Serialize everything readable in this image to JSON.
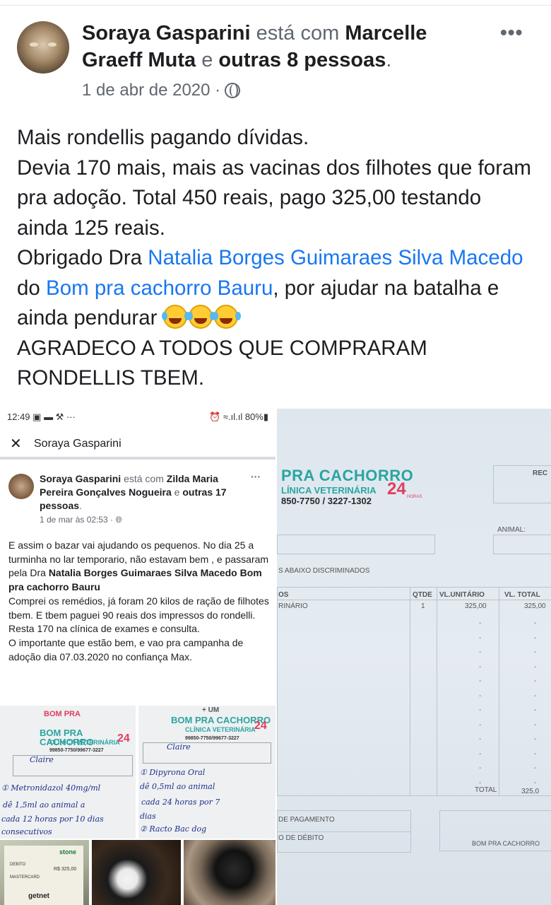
{
  "post": {
    "author": "Soraya Gasparini",
    "with_text": "está com",
    "tagged": "Marcelle Graeff Muta",
    "and_text": "e",
    "others": "outras 8 pessoas",
    "period": ".",
    "date": "1 de abr de 2020 ·",
    "more_icon": "•••",
    "body": {
      "line1": "Mais rondellis pagando dívidas.",
      "line2": "Devia 170 mais, mais as vacinas dos filhotes que foram pra adoção. Total 450 reais, pago 325,00 testando ainda 125 reais.",
      "thanks_prefix": "Obrigado Dra",
      "doctor_link": "Natalia Borges Guimaraes Silva Macedo",
      "from_text": "do",
      "clinic_link": "Bom pra cachorro Bauru",
      "thanks_suffix": ", por ajudar na batalha e ainda pendurar",
      "line4": "AGRADECO A TODOS QUE COMPRARAM RONDELLIS TBEM."
    }
  },
  "screenshot": {
    "status_time": "12:49",
    "status_icons_left": "▣ ▬ ⚒ ···",
    "status_right": "⏰ ≈.ıl.ıl 80%▮",
    "title": "Soraya Gasparini",
    "close_icon": "✕",
    "inner_post": {
      "author": "Soraya Gasparini",
      "with_text": "está com",
      "tagged": "Zilda Maria Pereira Gonçalves Nogueira",
      "and_text": "e",
      "others": "outras 17 pessoas",
      "period": ".",
      "date": "1 de mar às 02:53 ·",
      "more_icon": "···",
      "body_a": "E assim o bazar vai ajudando os pequenos. No dia 25 a turminha no lar temporario, não estavam bem , e passaram pela Dra",
      "body_bold": "Natalia Borges Guimaraes Silva Macedo Bom pra cachorro Bauru",
      "body_b": "Comprei os remédios,  já foram 20 kilos de ração de filhotes tbem. E tbem paguei 90 reais dos impressos do rondelli.",
      "body_c": "Resta 170 na clínica de exames e consulta.",
      "body_d": "O importante que estão bem, e vao pra campanha de adoção dia 07.03.2020 no confiança Max."
    },
    "receipt_a": {
      "logo_top": "BOM PRA",
      "logo": "BOM PRA CACHORRO",
      "sub": "CLÍNICA VETERINÁRIA",
      "phone": "99850-7750/99677-3227",
      "num": "24",
      "note1": "Claire",
      "note2": "① Metronidazol 40mg/ml",
      "note3": "dê 1,5ml ao animal a",
      "note4": "cada 12 horas por 10 dias",
      "note5": "consecutivos"
    },
    "receipt_b": {
      "logo_top": "+ UM",
      "logo": "BOM PRA CACHORRO",
      "sub": "CLÍNICA VETERINÁRIA",
      "phone": "99850-7750/99677-3227",
      "num": "24",
      "note1": "Claire",
      "note2": "① Dipyrona Oral",
      "note3": "dê 0,5ml ao animal",
      "note4": "cada 24 horas por 7",
      "note5": "dias",
      "note6": "② Racto Bac dog"
    },
    "card_brand": "stone",
    "card_debit": "DEBITO",
    "card_amount": "R$ 325,00",
    "card_issuer": "MASTERCARD",
    "card_footer": "getnet"
  },
  "receipt_photo": {
    "logo_line1": "PRA CACHORRO",
    "logo_line2": "LÍNICA VETERINÁRIA",
    "logo_line3": "850-7750 / 3227-1302",
    "logo_24": "24",
    "logo_horas": "HORAS",
    "rec": "REC",
    "animal_label": "ANIMAL:",
    "services_label": "S ABAIXO DISCRIMINADOS",
    "col_items": "OS",
    "col_qty": "QTDE",
    "col_unit": "VL.UNITÁRIO",
    "col_total": "VL. TOTAL",
    "row_item": "RINÁRIO",
    "row_qty": "1",
    "row_unit": "325,00",
    "row_total": "325,00",
    "total_label": "TOTAL",
    "total_value": "325,0",
    "payment_label": "DE PAGAMENTO",
    "debit_label": "O DE DÉBITO",
    "footer": "BOM PRA CACHORRO"
  }
}
